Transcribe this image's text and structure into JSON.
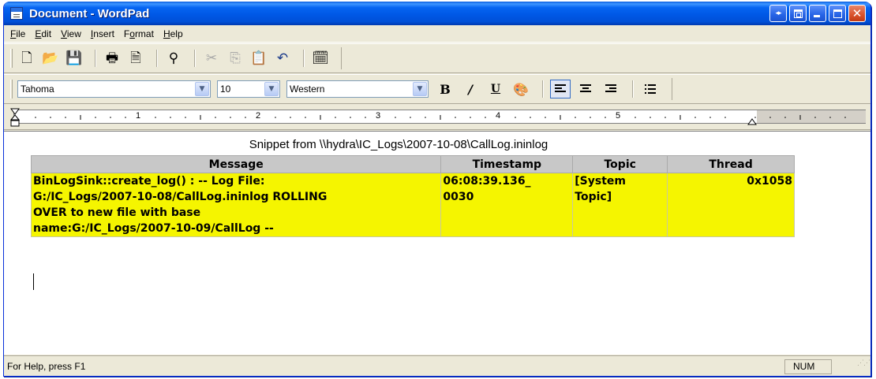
{
  "window": {
    "title": "Document - WordPad"
  },
  "menu": [
    {
      "label": "File",
      "accel": "F",
      "rest": "ile"
    },
    {
      "label": "Edit",
      "accel": "E",
      "rest": "dit"
    },
    {
      "label": "View",
      "accel": "V",
      "rest": "iew"
    },
    {
      "label": "Insert",
      "accel": "I",
      "rest": "nsert"
    },
    {
      "label": "Format",
      "pre": "F",
      "accel": "o",
      "rest": "rmat"
    },
    {
      "label": "Help",
      "accel": "H",
      "rest": "elp"
    }
  ],
  "toolbar": {
    "icons": [
      "new-icon",
      "open-icon",
      "save-icon",
      "print-icon",
      "print-preview-icon",
      "find-icon",
      "cut-icon",
      "copy-icon",
      "paste-icon",
      "undo-icon",
      "date-time-icon"
    ]
  },
  "format_bar": {
    "font": "Tahoma",
    "size": "10",
    "script": "Western"
  },
  "ruler": {
    "numbers": [
      "1",
      "2",
      "3",
      "4",
      "5"
    ]
  },
  "document": {
    "caption": "Snippet from \\\\hydra\\IC_Logs\\2007-10-08\\CallLog.ininlog",
    "table": {
      "headers": [
        "Message",
        "Timestamp",
        "Topic",
        "Thread"
      ],
      "rows": [
        {
          "message": [
            "BinLogSink::create_log() : -- Log File:",
            "G:/IC_Logs/2007-10-08/CallLog.ininlog ROLLING",
            "OVER to new file with base",
            "name:G:/IC_Logs/2007-10-09/CallLog --"
          ],
          "timestamp": [
            "06:08:39.136_",
            "0030"
          ],
          "topic": [
            "[System",
            "Topic]"
          ],
          "thread": "0x1058"
        }
      ]
    }
  },
  "status": {
    "help": "For Help, press F1",
    "num": "NUM"
  },
  "colors": {
    "highlight": "#f5f500",
    "header_bg": "#c8c8c8",
    "titlebar": "#0058e6"
  }
}
